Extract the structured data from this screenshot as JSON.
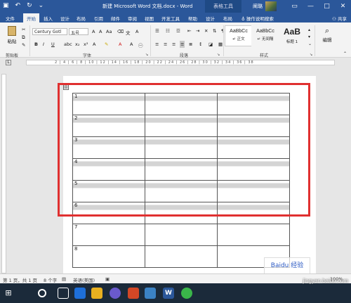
{
  "titlebar": {
    "title": "新建 Microsoft Word 文档.docx - Word",
    "contextual_tab": "表格工具",
    "user": "阐璐"
  },
  "tabs": [
    "文件",
    "开始",
    "插入",
    "设计",
    "布局",
    "引用",
    "邮件",
    "审阅",
    "视图",
    "开发工具",
    "帮助",
    "设计",
    "布局"
  ],
  "tell_me": "操作说明搜索",
  "share": "共享",
  "ribbon": {
    "paste_label": "粘贴",
    "clipboard_label": "剪贴板",
    "font_name": "Century Gotl",
    "font_size": "五号",
    "font_label": "字体",
    "paragraph_label": "段落",
    "styles_label": "样式",
    "editing_label": "编辑",
    "styles": [
      {
        "sample": "AaBbCc",
        "name": "↵ 正文"
      },
      {
        "sample": "AaBbCc",
        "name": "↵ 无间隔"
      },
      {
        "sample": "AaB",
        "name": "标题 1"
      }
    ]
  },
  "ruler_text": "2 | 4 | 6 | 8 | 10 | 12 | 14 | 16 | 18 | 20 | 22 | 24 | 26 | 28 | 30 | 32 | 34 | 36 | 38",
  "table": {
    "rows": [
      "1",
      "2",
      "3",
      "4",
      "5",
      "6",
      "7",
      "8"
    ],
    "shaded_rows": 6
  },
  "status": {
    "page": "第 1 页，共 1 页",
    "words": "8 个字",
    "lang": "英语(美国)",
    "zoom": "100%"
  },
  "watermark": "jingyan.baidu.com",
  "watermark_logo": "Baidu 经验"
}
